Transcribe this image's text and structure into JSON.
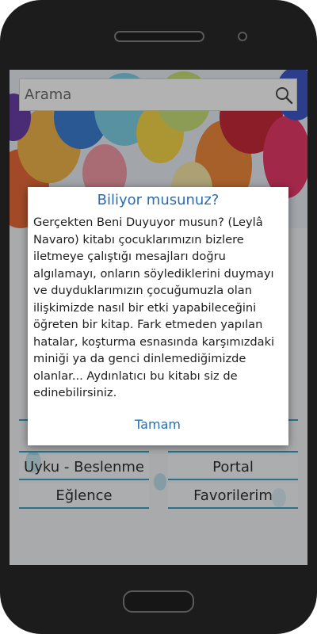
{
  "search": {
    "placeholder": "Arama",
    "icon": "search-icon"
  },
  "menu": {
    "items": [
      {
        "label": "Uyku - Beslenme"
      },
      {
        "label": "Portal"
      },
      {
        "label": "Eğlence"
      },
      {
        "label": "Favorilerim"
      }
    ]
  },
  "dialog": {
    "title": "Biliyor musunuz?",
    "body": "Gerçekten Beni Duyuyor musun? (Leylâ Navaro) kitabı çocuklarımızın bizlere iletmeye çalıştığı mesajları doğru algılamayı, onların söylediklerini duymayı ve duyduklarımızın çocuğumuzla olan ilişkimizde nasıl bir etki yapabileceğini öğreten bir kitap. Fark etmeden yapılan hatalar, koşturma esnasında karşımızdaki miniği ya da genci dinlemediğimizde olanlar... Aydınlatıcı bu kitabı siz de edinebilirsiniz.",
    "ok_label": "Tamam"
  },
  "colors": {
    "accent": "#2a6db0",
    "menu_underline": "#3aa2c4",
    "phone_body": "#1c1c1c"
  }
}
